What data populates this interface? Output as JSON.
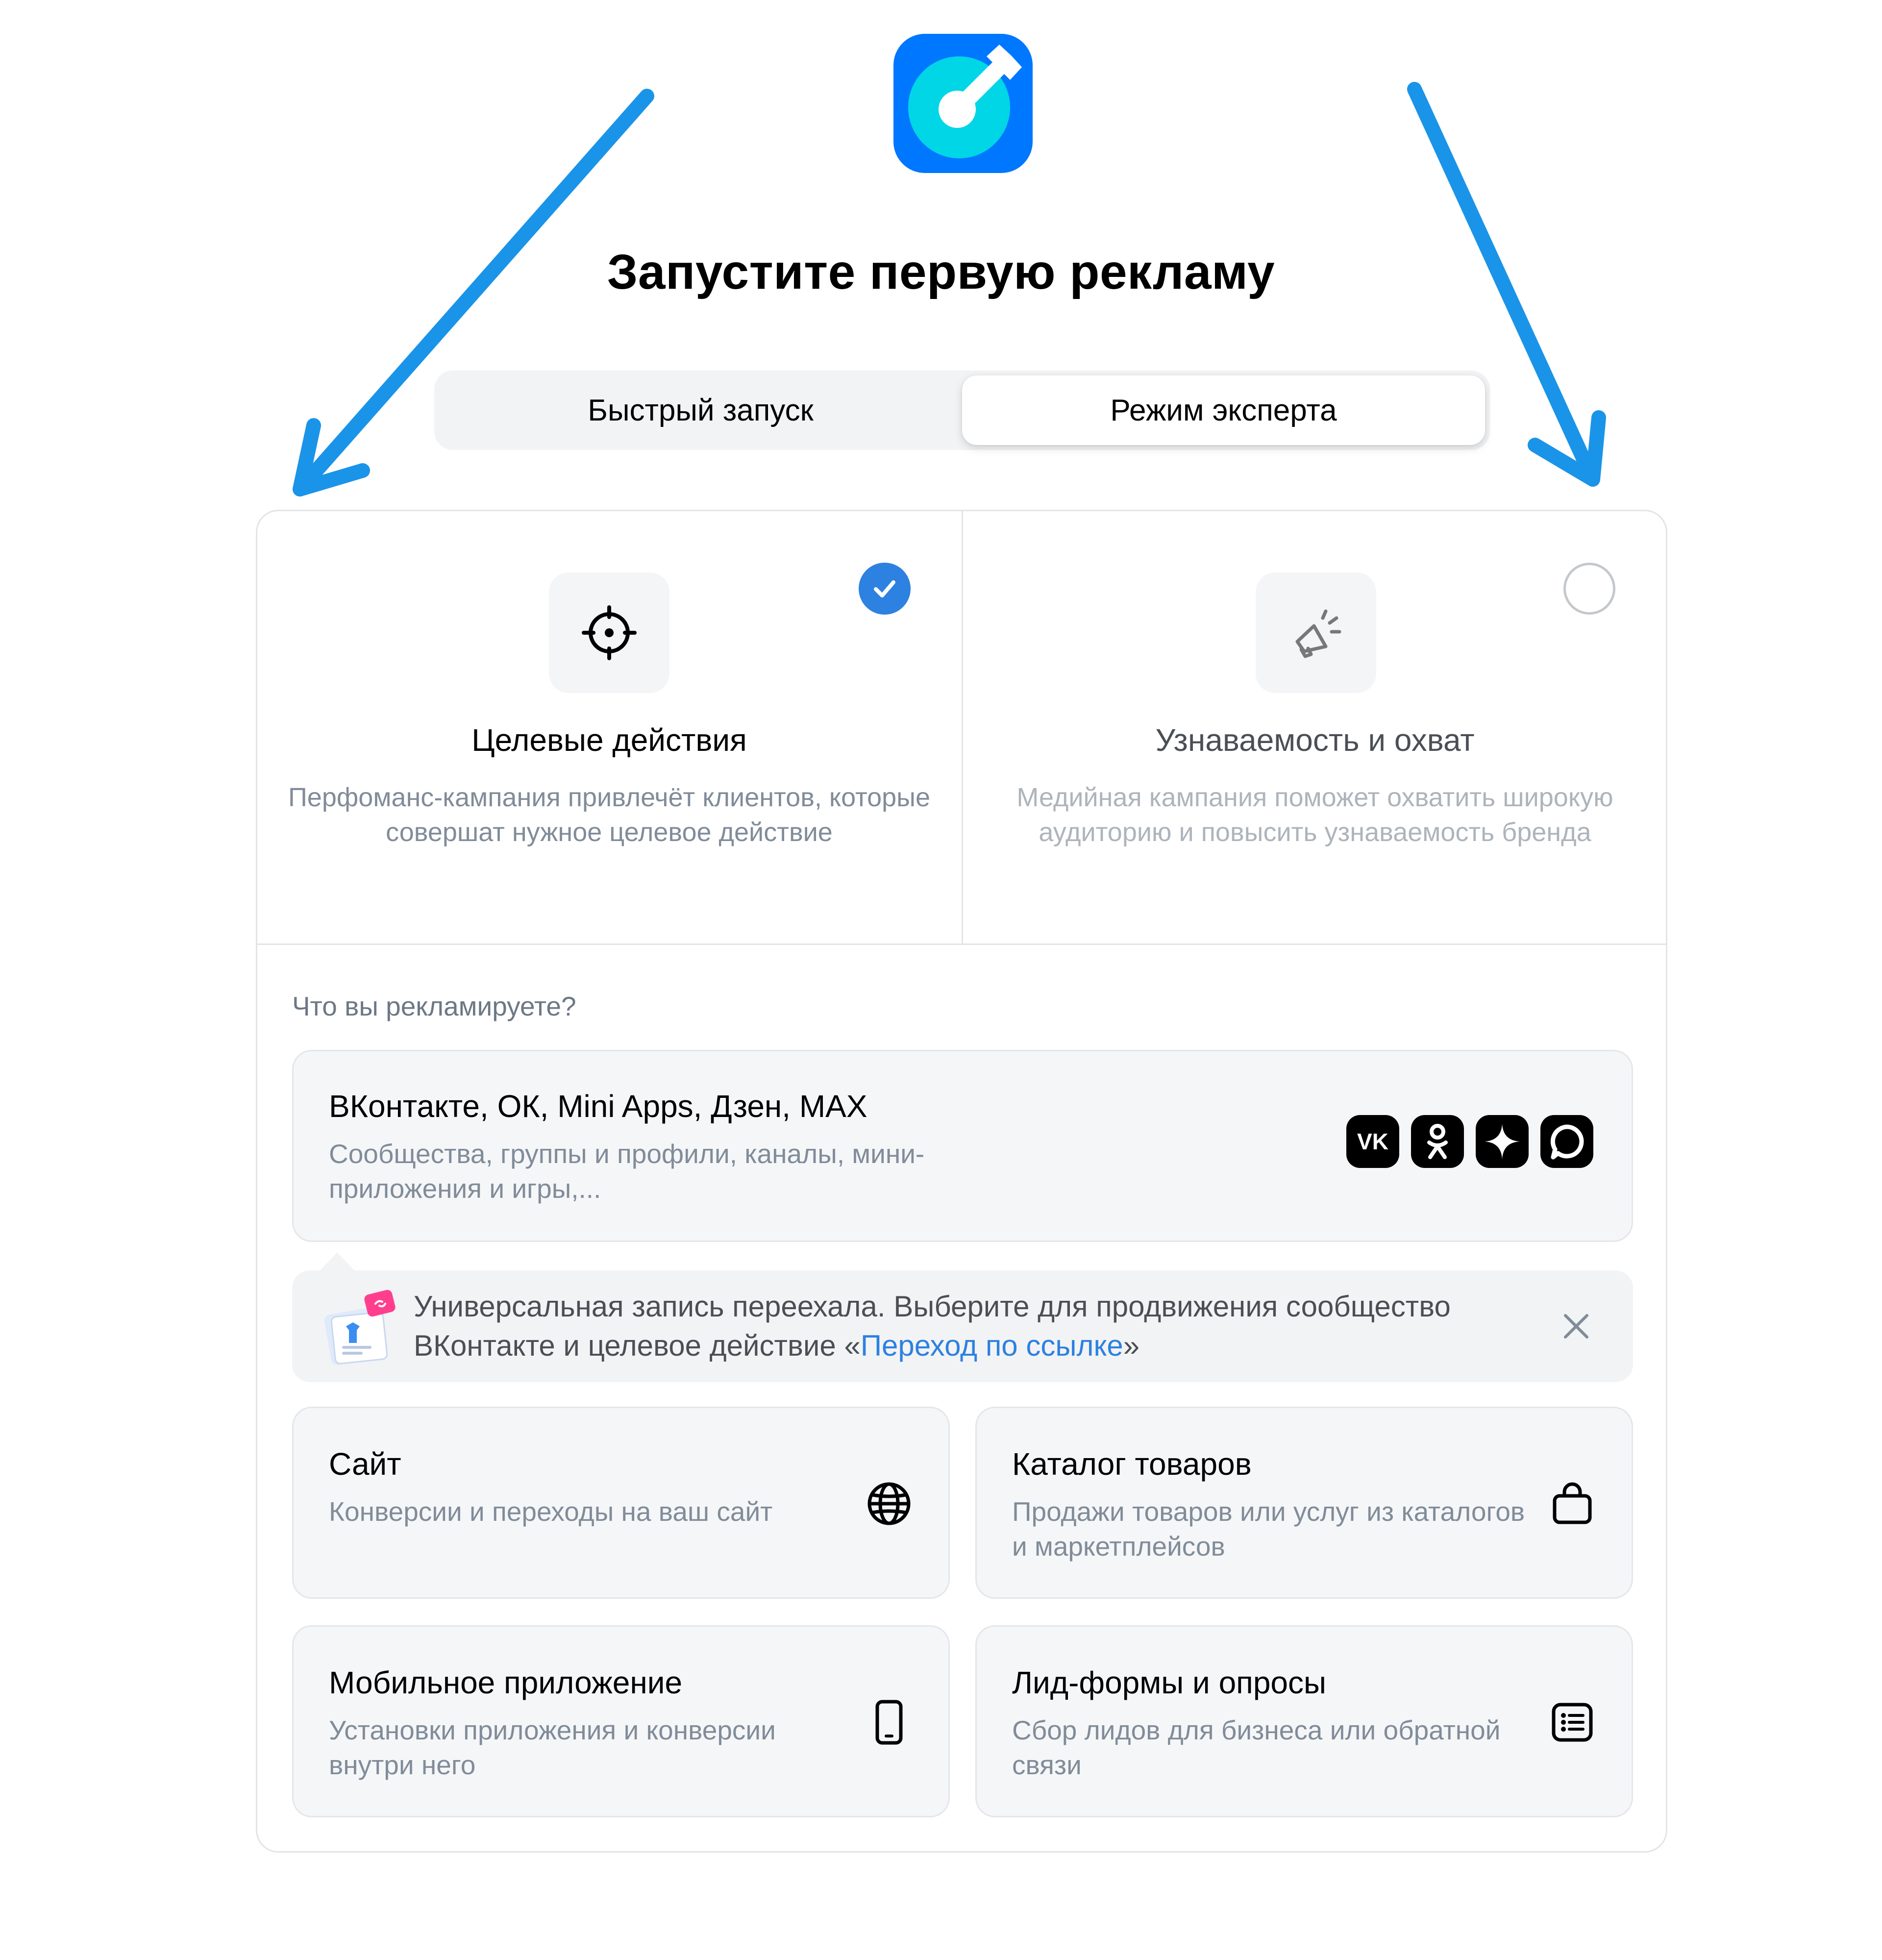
{
  "page": {
    "title": "Запустите первую рекламу"
  },
  "mode_switch": {
    "quick_label": "Быстрый запуск",
    "expert_label": "Режим эксперта",
    "selected": "expert"
  },
  "goals": {
    "actions": {
      "title": "Целевые действия",
      "description": "Перфоманс-кампания привлечёт клиентов, которые совершат нужное целевое действие",
      "selected": true,
      "icon": "target-icon"
    },
    "reach": {
      "title": "Узнаваемость и охват",
      "description": "Медийная кампания поможет охватить широкую аудиторию и повысить узнаваемость бренда",
      "selected": false,
      "icon": "megaphone-icon"
    }
  },
  "promote": {
    "question": "Что вы рекламируете?",
    "vk_card": {
      "title": "ВКонтакте, ОК, Mini Apps, Дзен, MAX",
      "description": "Сообщества, группы и профили, каналы, мини-приложения и игры,...",
      "icons": [
        "vk-icon",
        "ok-icon",
        "dzen-icon",
        "max-icon"
      ]
    },
    "notice": {
      "text_before": "Универсальная запись переехала. Выберите для продвижения сообщество ВКонтакте и целевое действие «",
      "link_text": "Переход по ссылке",
      "text_after": "»"
    },
    "options": {
      "site": {
        "title": "Сайт",
        "description": "Конверсии и переходы на ваш сайт",
        "icon": "globe-icon"
      },
      "catalog": {
        "title": "Каталог товаров",
        "description": "Продажи товаров или услуг из каталогов и маркетплейсов",
        "icon": "shopping-bag-icon"
      },
      "mobile": {
        "title": "Мобильное приложение",
        "description": "Установки приложения и конверсии внутри него",
        "icon": "smartphone-icon"
      },
      "leads": {
        "title": "Лид-формы и опросы",
        "description": "Сбор лидов для бизнеса или обратной связи",
        "icon": "list-icon"
      }
    }
  },
  "colors": {
    "accent": "#2d81e0",
    "arrow": "#1a94e8",
    "logo_blue": "#0077ff",
    "logo_cyan": "#00d6e6"
  }
}
